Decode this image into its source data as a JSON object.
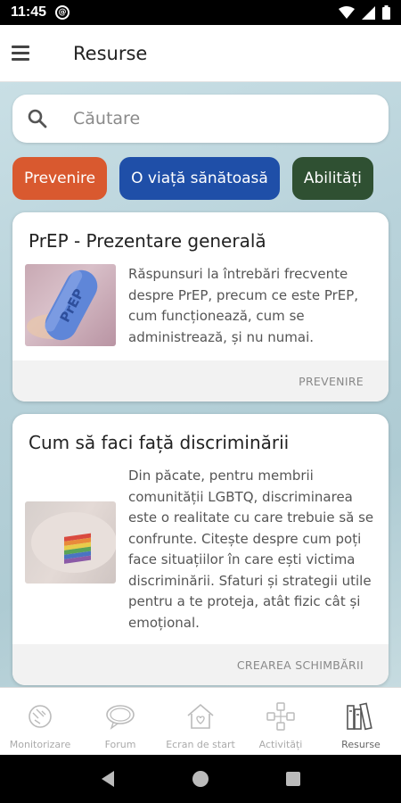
{
  "status_bar": {
    "time": "11:45"
  },
  "app_bar": {
    "title": "Resurse"
  },
  "search": {
    "placeholder": "Căutare"
  },
  "chips": [
    {
      "label": "Prevenire",
      "color": "#d9592f"
    },
    {
      "label": "O viață sănătoasă",
      "color": "#1f4fa8"
    },
    {
      "label": "Abilități",
      "color": "#2f5032"
    }
  ],
  "cards": [
    {
      "title": "PrEP - Prezentare generală",
      "description": "Răspunsuri la întrebări frecvente despre PrEP, precum ce este PrEP, cum funcționează, cum se administrează, și nu numai.",
      "category": "PREVENIRE",
      "image_icon": "prep-pill-photo",
      "pill_text": "PrEP"
    },
    {
      "title": "Cum să faci față discriminării",
      "description": "Din păcate, pentru membrii comunității LGBTQ, discriminarea este o realitate cu care trebuie să se confrunte. Citește despre cum poți face situațiilor în care ești victima discriminării. Sfaturi și strategii utile pentru a te proteja, atât fizic cât și emoțional.",
      "category": "CREAREA SCHIMBĂRII",
      "image_icon": "rainbow-flag-wrist-photo"
    }
  ],
  "bottom_nav": [
    {
      "label": "Monitorizare",
      "icon": "monitor-icon",
      "active": false
    },
    {
      "label": "Forum",
      "icon": "forum-icon",
      "active": false
    },
    {
      "label": "Ecran de start",
      "icon": "home-icon",
      "active": false
    },
    {
      "label": "Activități",
      "icon": "activities-icon",
      "active": false
    },
    {
      "label": "Resurse",
      "icon": "resources-icon",
      "active": true
    }
  ]
}
